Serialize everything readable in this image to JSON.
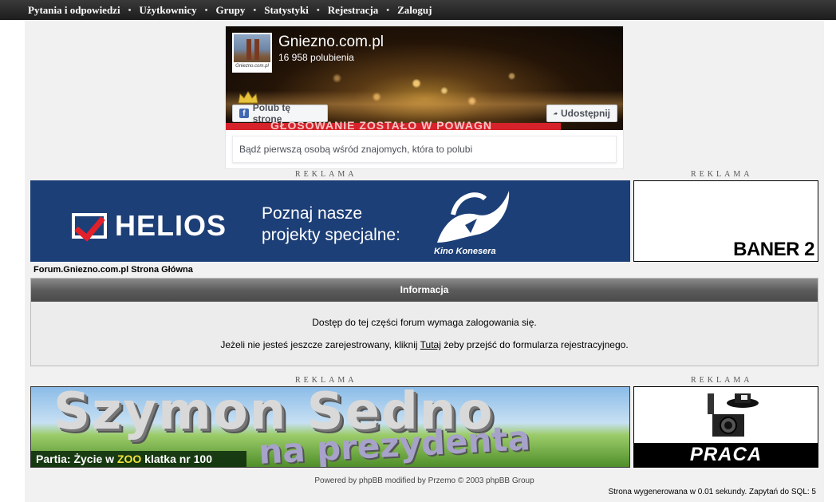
{
  "nav": {
    "items": [
      {
        "label": "Pytania i odpowiedzi"
      },
      {
        "label": "Użytkownicy"
      },
      {
        "label": "Grupy"
      },
      {
        "label": "Statystyki"
      },
      {
        "label": "Rejestracja"
      },
      {
        "label": "Zaloguj"
      }
    ],
    "separator": "•"
  },
  "facebook": {
    "page_name": "Gniezno.com.pl",
    "likes": "16 958 polubienia",
    "thumb_caption": "Gniezno.com.pl",
    "like_button": "Polub tę stronę",
    "share_button": "Udostępnij",
    "social_text": "Bądź pierwszą osobą wśród znajomych, która to polubi",
    "cover_strip_text": "GŁOSOWANIE ZOSTAŁO W POWAGN"
  },
  "ads": {
    "label": "REKLAMA",
    "helios": {
      "brand": "HELIOS",
      "line1": "Poznaj nasze",
      "line2": "projekty specjalne:",
      "caption": "Kino Konesera"
    },
    "baner2": "BANER 2",
    "szymon": {
      "title": "Szymon Sedno",
      "subtitle": "na prezydenta",
      "party_prefix": "Partia: Życie w ",
      "party_zoo": "ZOO",
      "party_suffix": " klatka nr 100"
    },
    "praca": "PRACA"
  },
  "breadcrumb": "Forum.Gniezno.com.pl Strona Główna",
  "info": {
    "title": "Informacja",
    "message": "Dostęp do tej części forum wymaga zalogowania się.",
    "register_prefix": "Jeżeli nie jesteś jeszcze zarejestrowany, kliknij ",
    "register_link": "Tutaj",
    "register_suffix": " żeby przejść do formularza rejestracyjnego."
  },
  "footer": {
    "powered": "Powered by phpBB modified by Przemo © 2003 phpBB Group",
    "stats": "Strona wygenerowana w 0.01 sekundy. Zapytań do SQL: 5"
  },
  "colors": {
    "facebook_blue": "#4267b2",
    "helios_blue": "#1d3f77",
    "helios_red": "#e3202a"
  }
}
